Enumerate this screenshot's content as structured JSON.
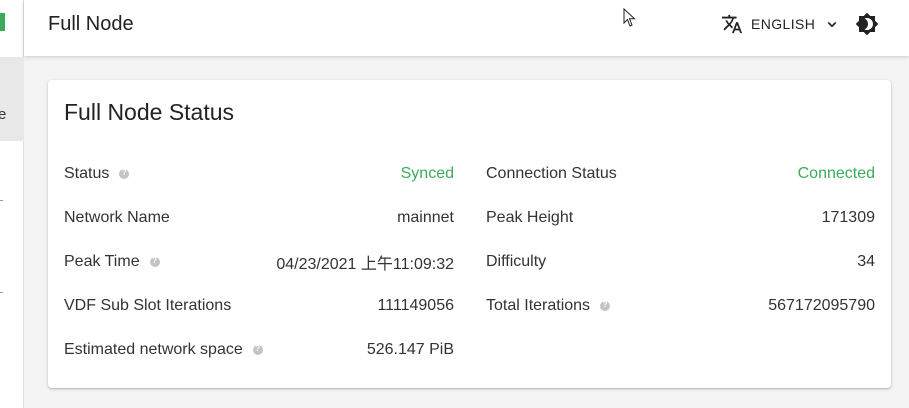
{
  "sidebar": {
    "partial_label": "e"
  },
  "appbar": {
    "title": "Full Node",
    "language_label": "ENGLISH",
    "icons": {
      "language": "translate-icon",
      "dropdown": "chevron-down-icon",
      "theme": "brightness-icon"
    }
  },
  "card": {
    "title": "Full Node Status",
    "left_rows": [
      {
        "label": "Status",
        "value": "Synced",
        "has_help": true,
        "value_color": "#3aac59"
      },
      {
        "label": "Network Name",
        "value": "mainnet",
        "has_help": false
      },
      {
        "label": "Peak Time",
        "value": "04/23/2021 上午11:09:32",
        "has_help": true
      },
      {
        "label": "VDF Sub Slot Iterations",
        "value": "111149056",
        "has_help": false
      },
      {
        "label": "Estimated network space",
        "value": "526.147 PiB",
        "has_help": true
      }
    ],
    "right_rows": [
      {
        "label": "Connection Status",
        "value": "Connected",
        "has_help": false,
        "value_color": "#3aac59"
      },
      {
        "label": "Peak Height",
        "value": "171309",
        "has_help": false
      },
      {
        "label": "Difficulty",
        "value": "34",
        "has_help": false
      },
      {
        "label": "Total Iterations",
        "value": "567172095790",
        "has_help": true
      }
    ]
  }
}
